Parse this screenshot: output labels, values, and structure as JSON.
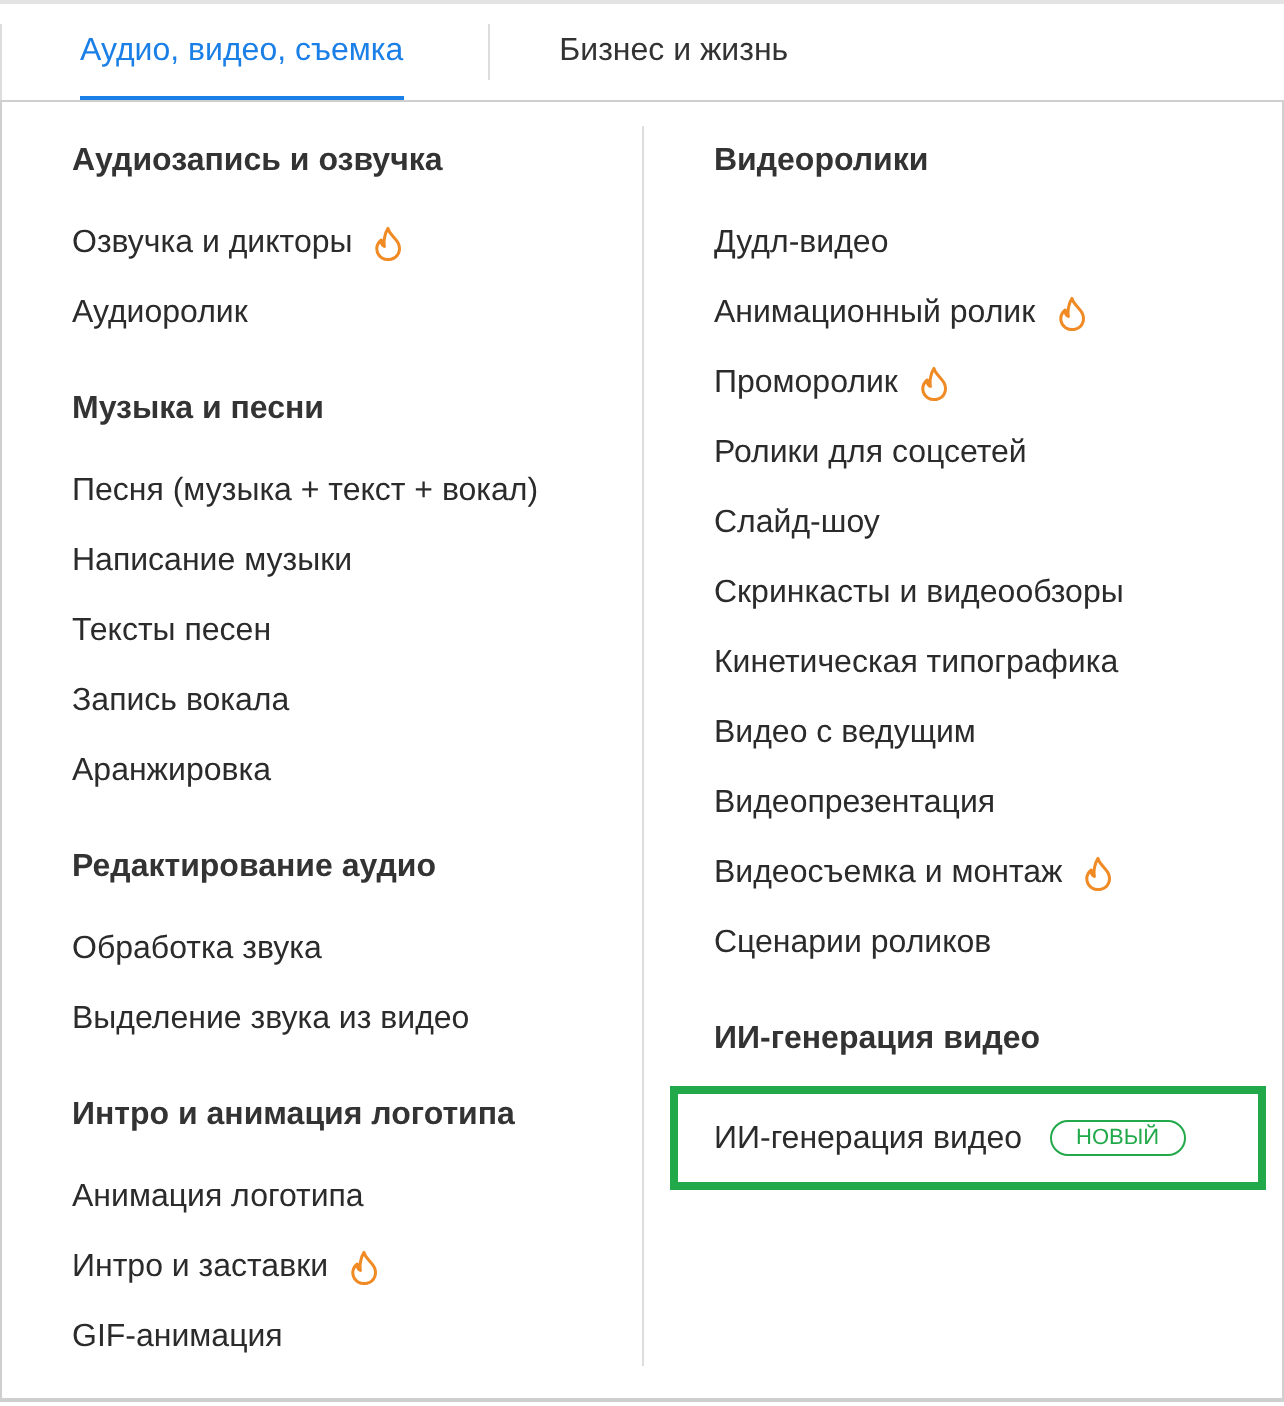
{
  "tabs": [
    {
      "label": "Аудио, видео, съемка",
      "selected": true
    },
    {
      "label": "Бизнес и жизнь",
      "selected": false
    }
  ],
  "columns": [
    {
      "groups": [
        {
          "heading": "Аудиозапись и озвучка",
          "items": [
            {
              "label": "Озвучка и дикторы",
              "hot": true,
              "highlighted": false
            },
            {
              "label": "Аудиоролик",
              "hot": false,
              "highlighted": false
            }
          ]
        },
        {
          "heading": "Музыка и песни",
          "items": [
            {
              "label": "Песня (музыка + текст + вокал)",
              "hot": false,
              "highlighted": false
            },
            {
              "label": "Написание музыки",
              "hot": false,
              "highlighted": false
            },
            {
              "label": "Тексты песен",
              "hot": false,
              "highlighted": false
            },
            {
              "label": "Запись вокала",
              "hot": false,
              "highlighted": false
            },
            {
              "label": "Аранжировка",
              "hot": false,
              "highlighted": false
            }
          ]
        },
        {
          "heading": "Редактирование аудио",
          "items": [
            {
              "label": "Обработка звука",
              "hot": false,
              "highlighted": false
            },
            {
              "label": "Выделение звука из видео",
              "hot": false,
              "highlighted": false
            }
          ]
        },
        {
          "heading": "Интро и анимация логотипа",
          "items": [
            {
              "label": "Анимация логотипа",
              "hot": false,
              "highlighted": false
            },
            {
              "label": "Интро и заставки",
              "hot": true,
              "highlighted": false
            },
            {
              "label": "GIF-анимация",
              "hot": false,
              "highlighted": false
            }
          ]
        }
      ]
    },
    {
      "groups": [
        {
          "heading": "Видеоролики",
          "items": [
            {
              "label": "Дудл-видео",
              "hot": false,
              "highlighted": false
            },
            {
              "label": "Анимационный ролик",
              "hot": true,
              "highlighted": false
            },
            {
              "label": "Проморолик",
              "hot": true,
              "highlighted": false
            },
            {
              "label": "Ролики для соцсетей",
              "hot": false,
              "highlighted": false
            },
            {
              "label": "Слайд-шоу",
              "hot": false,
              "highlighted": false
            },
            {
              "label": "Скринкасты и видеообзоры",
              "hot": false,
              "highlighted": false
            },
            {
              "label": "Кинетическая типографика",
              "hot": false,
              "highlighted": false
            },
            {
              "label": "Видео с ведущим",
              "hot": false,
              "highlighted": false
            },
            {
              "label": "Видеопрезентация",
              "hot": false,
              "highlighted": false
            },
            {
              "label": "Видеосъемка и монтаж",
              "hot": true,
              "highlighted": false
            },
            {
              "label": "Сценарии роликов",
              "hot": false,
              "highlighted": false
            }
          ]
        },
        {
          "heading": "ИИ-генерация видео",
          "items": [
            {
              "label": "ИИ-генерация видео",
              "hot": false,
              "highlighted": true,
              "badge": "НОВЫЙ"
            }
          ]
        }
      ]
    }
  ]
}
